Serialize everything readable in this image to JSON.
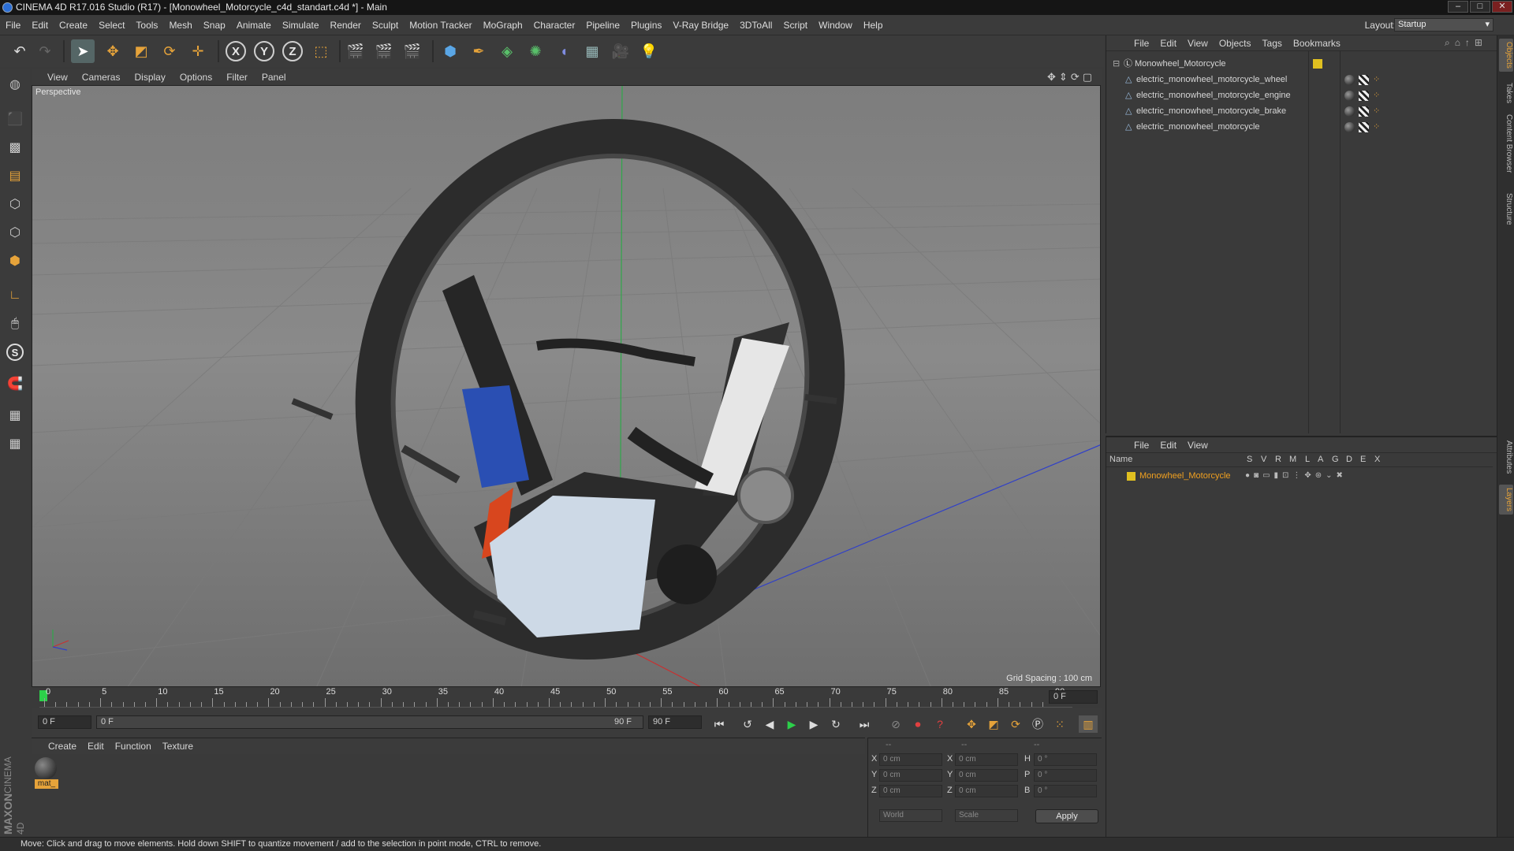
{
  "window": {
    "title": "CINEMA 4D R17.016 Studio (R17) - [Monowheel_Motorcycle_c4d_standart.c4d *] - Main",
    "minimize": "–",
    "maximize": "□",
    "close": "✕"
  },
  "menubar": {
    "items": [
      "File",
      "Edit",
      "Create",
      "Select",
      "Tools",
      "Mesh",
      "Snap",
      "Animate",
      "Simulate",
      "Render",
      "Sculpt",
      "Motion Tracker",
      "MoGraph",
      "Character",
      "Pipeline",
      "Plugins",
      "V-Ray Bridge",
      "3DToAll",
      "Script",
      "Window",
      "Help"
    ],
    "layout_label": "Layout:",
    "layout_value": "Startup"
  },
  "toolbar": {
    "axis_x": "X",
    "axis_y": "Y",
    "axis_z": "Z"
  },
  "left_tools": {
    "s_label": "S"
  },
  "viewport": {
    "menu": [
      "View",
      "Cameras",
      "Display",
      "Options",
      "Filter",
      "Panel"
    ],
    "label": "Perspective",
    "grid_spacing": "Grid Spacing : 100 cm"
  },
  "timeline": {
    "ticks": [
      "0",
      "5",
      "10",
      "15",
      "20",
      "25",
      "30",
      "35",
      "40",
      "45",
      "50",
      "55",
      "60",
      "65",
      "70",
      "75",
      "80",
      "85",
      "90"
    ],
    "current_frame_field": "0 F",
    "start_field": "0 F",
    "range_start": "0 F",
    "range_end": "90 F",
    "end_field": "90 F"
  },
  "material_manager": {
    "menu": [
      "Create",
      "Edit",
      "Function",
      "Texture"
    ],
    "materials": [
      {
        "name": "mat_"
      }
    ]
  },
  "coordinates": {
    "header": [
      "--",
      "--",
      "--"
    ],
    "rows": [
      {
        "a": "X",
        "av": "0 cm",
        "b": "X",
        "bv": "0 cm",
        "c": "H",
        "cv": "0 °"
      },
      {
        "a": "Y",
        "av": "0 cm",
        "b": "Y",
        "bv": "0 cm",
        "c": "P",
        "cv": "0 °"
      },
      {
        "a": "Z",
        "av": "0 cm",
        "b": "Z",
        "bv": "0 cm",
        "c": "B",
        "cv": "0 °"
      }
    ],
    "world": "World",
    "scale": "Scale",
    "apply": "Apply"
  },
  "object_manager": {
    "menu": [
      "File",
      "Edit",
      "View",
      "Objects",
      "Tags",
      "Bookmarks"
    ],
    "objects": [
      {
        "name": "Monowheel_Motorcycle",
        "root": true
      },
      {
        "name": "electric_monowheel_motorcycle_wheel"
      },
      {
        "name": "electric_monowheel_motorcycle_engine"
      },
      {
        "name": "electric_monowheel_motorcycle_brake"
      },
      {
        "name": "electric_monowheel_motorcycle"
      }
    ]
  },
  "layer_manager": {
    "menu": [
      "File",
      "Edit",
      "View"
    ],
    "columns": [
      "Name",
      "S",
      "V",
      "R",
      "M",
      "L",
      "A",
      "G",
      "D",
      "E",
      "X"
    ],
    "layers": [
      {
        "name": "Monowheel_Motorcycle",
        "color": "#e0c020"
      }
    ]
  },
  "right_tabs": [
    "Objects",
    "Takes",
    "Content Browser",
    "Structure",
    "Attributes",
    "Layers"
  ],
  "brand": {
    "line1": "MAXON",
    "line2": "CINEMA 4D"
  },
  "status": "Move: Click and drag to move elements. Hold down SHIFT to quantize movement / add to the selection in point mode, CTRL to remove.",
  "colors": {
    "accent": "#e6a33a",
    "layer_name": "#f0a020",
    "root_layer": "#e0c020"
  }
}
